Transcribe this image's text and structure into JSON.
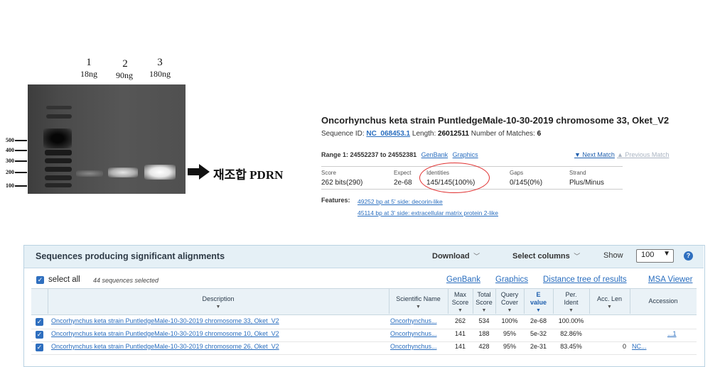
{
  "gel": {
    "lanes": [
      {
        "num": "1",
        "amount": "18ng"
      },
      {
        "num": "2",
        "amount": "90ng"
      },
      {
        "num": "3",
        "amount": "180ng"
      }
    ],
    "ladder": [
      "500",
      "400",
      "300",
      "200",
      "100"
    ],
    "arrow_label": "재조합 PDRN"
  },
  "blast_top": {
    "title": "Oncorhynchus keta strain PuntledgeMale-10-30-2019 chromosome 33, Oket_V2",
    "seq_id_label": "Sequence ID:",
    "seq_id": "NC_068453.1",
    "length_label": "Length:",
    "length": "26012511",
    "matches_label": "Number of Matches:",
    "matches": "6",
    "range_text": "Range 1: 24552237 to 24552381",
    "genbank": "GenBank",
    "graphics": "Graphics",
    "next_match": "▼ Next Match",
    "prev_match": "▲ Previous Match",
    "headers": [
      "Score",
      "Expect",
      "Identities",
      "Gaps",
      "Strand"
    ],
    "values": [
      "262 bits(290)",
      "2e-68",
      "145/145(100%)",
      "0/145(0%)",
      "Plus/Minus"
    ],
    "features_label": "Features:",
    "features": [
      "49252 bp at 5' side: decorin-like",
      "45114 bp at 3' side: extracellular matrix protein 2-like"
    ]
  },
  "results": {
    "title": "Sequences producing significant alignments",
    "download": "Download",
    "select_columns": "Select columns",
    "show_label": "Show",
    "show_value": "100",
    "help": "?",
    "select_all": "select all",
    "selected_count": "44 sequences selected",
    "toolbar_links": [
      "GenBank",
      "Graphics",
      "Distance tree of results",
      "MSA Viewer"
    ],
    "columns": [
      {
        "label": "Description",
        "sub": ""
      },
      {
        "label": "Scientific Name",
        "sub": ""
      },
      {
        "label": "Max",
        "sub": "Score"
      },
      {
        "label": "Total",
        "sub": "Score"
      },
      {
        "label": "Query",
        "sub": "Cover"
      },
      {
        "label": "E",
        "sub": "value"
      },
      {
        "label": "Per.",
        "sub": "Ident"
      },
      {
        "label": "Acc. Len",
        "sub": ""
      },
      {
        "label": "Accession",
        "sub": ""
      }
    ],
    "rows": [
      {
        "desc": "Oncorhynchus keta strain PuntledgeMale-10-30-2019 chromosome 33, Oket_V2",
        "sci": "Oncorhynchus...",
        "max": "262",
        "total": "534",
        "cover": "100%",
        "evalue": "2e-68",
        "ident": "100.00%",
        "acclen": "",
        "acc": ""
      },
      {
        "desc": "Oncorhynchus keta strain PuntledgeMale-10-30-2019 chromosome 10, Oket_V2",
        "sci": "Oncorhynchus...",
        "max": "141",
        "total": "188",
        "cover": "95%",
        "evalue": "5e-32",
        "ident": "82.86%",
        "acclen": "",
        "acc": "...1"
      },
      {
        "desc": "Oncorhynchus keta strain PuntledgeMale-10-30-2019 chromosome 26, Oket_V2",
        "sci": "Oncorhynchus...",
        "max": "141",
        "total": "428",
        "cover": "95%",
        "evalue": "2e-31",
        "ident": "83.45%",
        "acclen": "0",
        "acc": "NC..."
      }
    ]
  }
}
